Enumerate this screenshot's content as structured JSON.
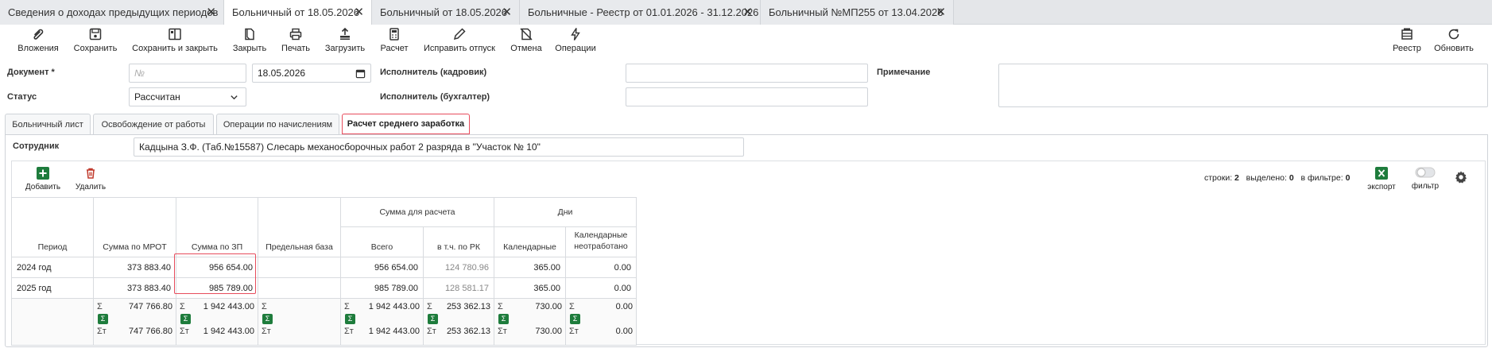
{
  "doc_tabs": [
    {
      "label": "Сведения о доходах предыдущих периодов"
    },
    {
      "label": "Больничный от 18.05.2026"
    },
    {
      "label": "Больничный от 18.05.2026"
    },
    {
      "label": "Больничные - Реестр от 01.01.2026 - 31.12.2026"
    },
    {
      "label": "Больничный №МП255 от 13.04.2026"
    }
  ],
  "close_glyph": "✕",
  "toolbar": {
    "attachments": "Вложения",
    "save": "Сохранить",
    "save_close": "Сохранить и закрыть",
    "close": "Закрыть",
    "print": "Печать",
    "load": "Загрузить",
    "calc": "Расчет",
    "fix_vacation": "Исправить отпуск",
    "cancel": "Отмена",
    "operations": "Операции",
    "registry": "Реестр",
    "refresh": "Обновить"
  },
  "form": {
    "document_label": "Документ *",
    "number_placeholder": "№",
    "date": "18.05.2026",
    "status_label": "Статус",
    "status_value": "Рассчитан",
    "executor_hr_label": "Исполнитель (кадровик)",
    "executor_acc_label": "Исполнитель (бухгалтер)",
    "note_label": "Примечание",
    "employee_label": "Сотрудник",
    "employee_value": "Кадцына З.Ф. (Таб.№15587) Слесарь механосборочных работ 2 разряда в \"Участок № 10\""
  },
  "inner_tabs": [
    {
      "label": "Больничный лист"
    },
    {
      "label": "Освобождение от работы"
    },
    {
      "label": "Операции по начислениям"
    },
    {
      "label": "Расчет среднего заработка"
    }
  ],
  "grid_toolbar": {
    "add": "Добавить",
    "delete": "Удалить",
    "rows_label": "строки:",
    "rows_value": "2",
    "selected_label": "выделено:",
    "selected_value": "0",
    "filtered_label": "в фильтре:",
    "filtered_value": "0",
    "export": "экспорт",
    "filter": "фильтр"
  },
  "table": {
    "headers": {
      "period": "Период",
      "mrot": "Сумма по МРОТ",
      "zp": "Сумма по ЗП",
      "limit": "Предельная база",
      "sum_group": "Сумма для расчета",
      "total": "Всего",
      "rk": "в т.ч. по РК",
      "days_group": "Дни",
      "calendar": "Календарные",
      "cal_unworked_1": "Календарные",
      "cal_unworked_2": "неотработано"
    },
    "rows": [
      {
        "period": "2024 год",
        "mrot": "373 883.40",
        "zp": "956 654.00",
        "limit": "",
        "total": "956 654.00",
        "rk": "124 780.96",
        "calendar": "365.00",
        "unworked": "0.00"
      },
      {
        "period": "2025 год",
        "mrot": "373 883.40",
        "zp": "985 789.00",
        "limit": "",
        "total": "985 789.00",
        "rk": "128 581.17",
        "calendar": "365.00",
        "unworked": "0.00"
      }
    ],
    "sums": {
      "mrot": "747 766.80",
      "mrot_f": "747 766.80",
      "zp": "1 942 443.00",
      "zp_f": "1 942 443.00",
      "total": "1 942 443.00",
      "total_f": "1 942 443.00",
      "rk": "253 362.13",
      "rk_f": "253 362.13",
      "calendar": "730.00",
      "calendar_f": "730.00",
      "unworked": "0.00",
      "unworked_f": "0.00"
    },
    "sigma": "Σ",
    "sigma_f": "Σт"
  },
  "colors": {
    "accent_red": "#e74c5c",
    "green": "#1e7c3c",
    "delete_red": "#c0392b"
  }
}
